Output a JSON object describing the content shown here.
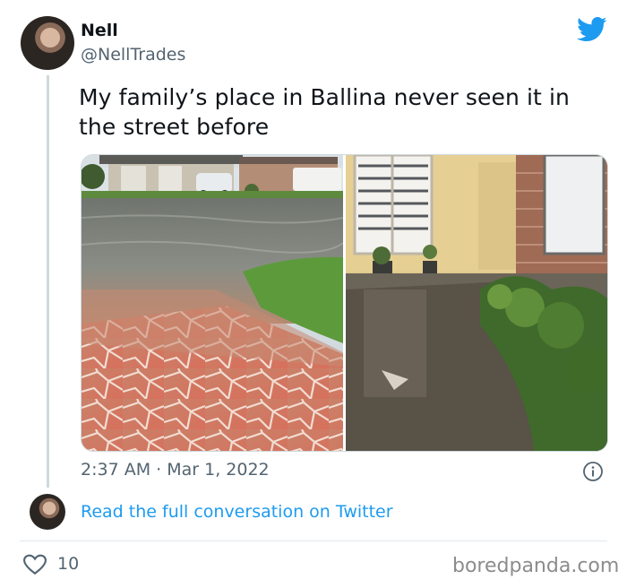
{
  "author": {
    "name": "Nell",
    "handle": "@NellTrades"
  },
  "tweet": {
    "text": "My family’s place in Ballina never seen it in the street before",
    "timestamp": "2:37 AM · Mar 1, 2022",
    "likes": "10"
  },
  "conversation_link": "Read the full conversation on Twitter",
  "watermark": "boredpanda.com",
  "icons": {
    "brand": "twitter-bird-icon",
    "info": "info-icon",
    "like": "heart-icon"
  },
  "colors": {
    "accent": "#1d9bf0",
    "text": "#0f1419",
    "muted": "#536471"
  }
}
